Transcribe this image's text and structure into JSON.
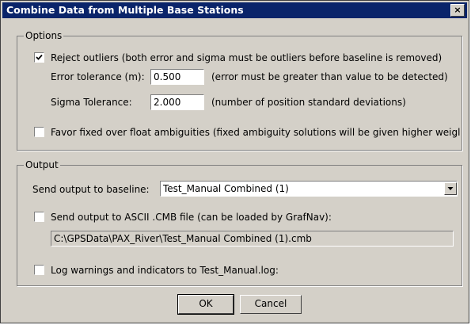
{
  "window": {
    "title": "Combine Data from Multiple Base Stations",
    "close_label": "×"
  },
  "options": {
    "legend": "Options",
    "reject_outliers": {
      "label": "Reject outliers (both error and sigma must be outliers before baseline is removed)",
      "checked": true
    },
    "error_tolerance": {
      "label": "Error tolerance (m):",
      "value": "0.500",
      "hint": "(error must be greater than value to be detected)"
    },
    "sigma_tolerance": {
      "label": "Sigma Tolerance:",
      "value": "2.000",
      "hint": "(number of position standard deviations)"
    },
    "favor_fixed": {
      "label": "Favor fixed over float ambiguities (fixed ambiguity solutions will be given higher weigl",
      "checked": false
    }
  },
  "output": {
    "legend": "Output",
    "send_to_baseline": {
      "label": "Send output to baseline:",
      "selected": "Test_Manual Combined (1)"
    },
    "send_to_ascii": {
      "label": "Send output to ASCII .CMB file (can be loaded by GrafNav):",
      "checked": false,
      "path": "C:\\GPSData\\PAX_River\\Test_Manual Combined (1).cmb"
    },
    "log_warnings": {
      "label": "Log warnings and indicators to Test_Manual.log:",
      "checked": false
    }
  },
  "buttons": {
    "ok": "OK",
    "cancel": "Cancel"
  }
}
